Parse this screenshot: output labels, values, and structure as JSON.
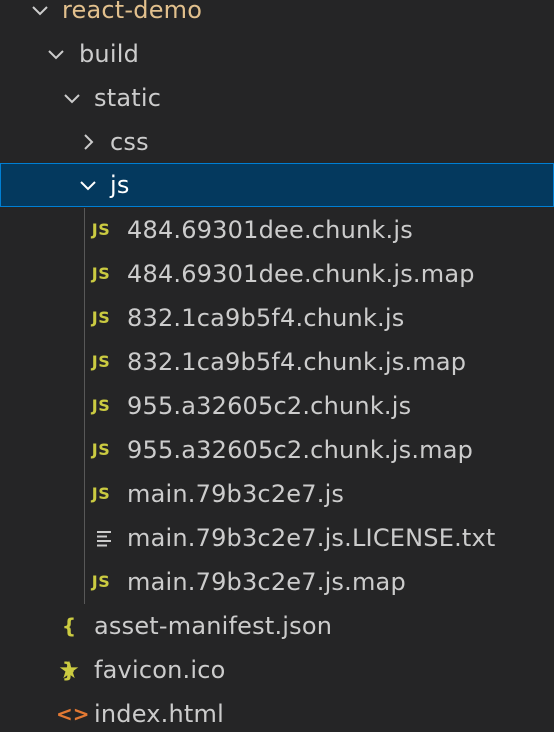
{
  "explorer": {
    "root": {
      "label": "react-demo",
      "icon": "chevron-down-icon"
    },
    "build": {
      "label": "build",
      "icon": "chevron-down-icon"
    },
    "static": {
      "label": "static",
      "icon": "chevron-down-icon"
    },
    "css": {
      "label": "css",
      "icon": "chevron-right-icon"
    },
    "js": {
      "label": "js",
      "icon": "chevron-down-icon",
      "selected": true
    },
    "js_files": [
      {
        "name": "484.69301dee.chunk.js",
        "icon": "js-file-icon",
        "badge": "JS"
      },
      {
        "name": "484.69301dee.chunk.js.map",
        "icon": "js-file-icon",
        "badge": "JS"
      },
      {
        "name": "832.1ca9b5f4.chunk.js",
        "icon": "js-file-icon",
        "badge": "JS"
      },
      {
        "name": "832.1ca9b5f4.chunk.js.map",
        "icon": "js-file-icon",
        "badge": "JS"
      },
      {
        "name": "955.a32605c2.chunk.js",
        "icon": "js-file-icon",
        "badge": "JS"
      },
      {
        "name": "955.a32605c2.chunk.js.map",
        "icon": "js-file-icon",
        "badge": "JS"
      },
      {
        "name": "main.79b3c2e7.js",
        "icon": "js-file-icon",
        "badge": "JS"
      },
      {
        "name": "main.79b3c2e7.js.LICENSE.txt",
        "icon": "text-file-icon",
        "badge": ""
      },
      {
        "name": "main.79b3c2e7.js.map",
        "icon": "js-file-icon",
        "badge": "JS"
      }
    ],
    "build_files": [
      {
        "name": "asset-manifest.json",
        "icon": "json-file-icon",
        "badge": "{ }"
      },
      {
        "name": "favicon.ico",
        "icon": "star-icon",
        "badge": "★"
      },
      {
        "name": "index.html",
        "icon": "html-file-icon",
        "badge": "<>"
      }
    ]
  },
  "colors": {
    "background": "#252526",
    "text": "#cccccc",
    "root_text": "#e2c08d",
    "selection_bg": "#04395e",
    "selection_border": "#007fd4",
    "js_icon": "#cbcb41",
    "html_icon": "#e37933"
  }
}
